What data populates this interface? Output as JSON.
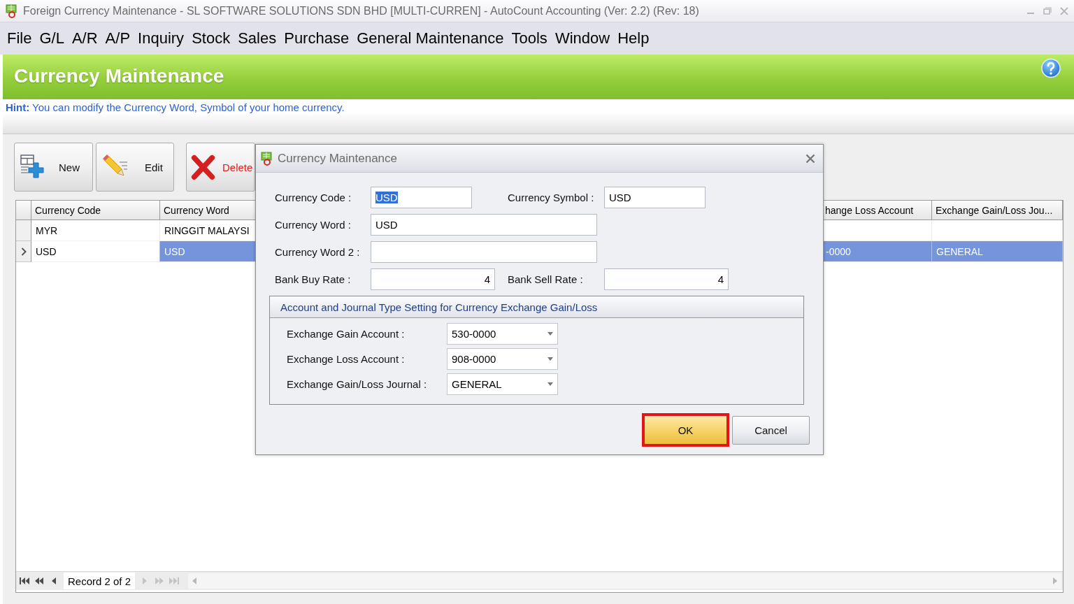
{
  "window": {
    "title": "Foreign Currency Maintenance - SL SOFTWARE SOLUTIONS SDN BHD [MULTI-CURREN] - AutoCount Accounting (Ver: 2.2) (Rev: 18)"
  },
  "menu": [
    "File",
    "G/L",
    "A/R",
    "A/P",
    "Inquiry",
    "Stock",
    "Sales",
    "Purchase",
    "General Maintenance",
    "Tools",
    "Window",
    "Help"
  ],
  "header": {
    "title": "Currency Maintenance"
  },
  "hint": "**Hint:** You can modify the Currency Word, Symbol of your home currency.",
  "toolbar": [
    {
      "kind": "new",
      "label": "New"
    },
    {
      "kind": "edit",
      "label": "Edit"
    },
    {
      "kind": "delete",
      "label": "Delete"
    }
  ],
  "grid": {
    "columns": [
      "Currency Code",
      "Currency Word",
      "hange Loss Account",
      "Exchange Gain/Loss Jou..."
    ],
    "rows": [
      {
        "selected": false,
        "cells": [
          "MYR",
          "RINGGIT MALAYSI"
        ]
      },
      {
        "selected": true,
        "cells": [
          "USD",
          "USD",
          "-0000",
          "GENERAL"
        ]
      }
    ],
    "navigator": {
      "record": "Record 2 of 2",
      "buttons": [
        {
          "kind": "first",
          "disabled": false
        },
        {
          "kind": "rewind",
          "disabled": false
        },
        {
          "kind": "prev",
          "disabled": false
        },
        {
          "kind": "next",
          "disabled": true
        },
        {
          "kind": "forward",
          "disabled": true
        },
        {
          "kind": "last",
          "disabled": true
        }
      ]
    }
  },
  "dialog": {
    "title": "Currency Maintenance",
    "rows": [
      [
        {
          "label": "Currency Code :",
          "kind": "short",
          "value": "USD",
          "text_selected": true
        },
        {
          "label": "Currency Symbol :",
          "kind": "short",
          "value": "USD",
          "text_selected": false
        }
      ],
      [
        {
          "label": "Currency Word :",
          "kind": "long",
          "value": "USD",
          "text_selected": false
        }
      ],
      [
        {
          "label": "Currency Word 2 :",
          "kind": "long"
        }
      ],
      [
        {
          "label": "Bank Buy Rate :",
          "kind": "number",
          "value": "4",
          "text_selected": false
        },
        {
          "label": "Bank Sell Rate :",
          "kind": "number",
          "value": "4",
          "text_selected": false
        }
      ]
    ],
    "group": {
      "title": "Account and Journal Type Setting for Currency Exchange Gain/Loss",
      "fields": [
        {
          "label": "Exchange Gain Account :",
          "value": "530-0000"
        },
        {
          "label": "Exchange Loss Account :",
          "value": "908-0000"
        },
        {
          "label": "Exchange Gain/Loss Journal :",
          "value": "GENERAL"
        }
      ]
    },
    "buttons": [
      {
        "label": "OK",
        "default": true,
        "highlighted": true
      },
      {
        "label": "Cancel",
        "default": false,
        "highlighted": false
      }
    ]
  }
}
